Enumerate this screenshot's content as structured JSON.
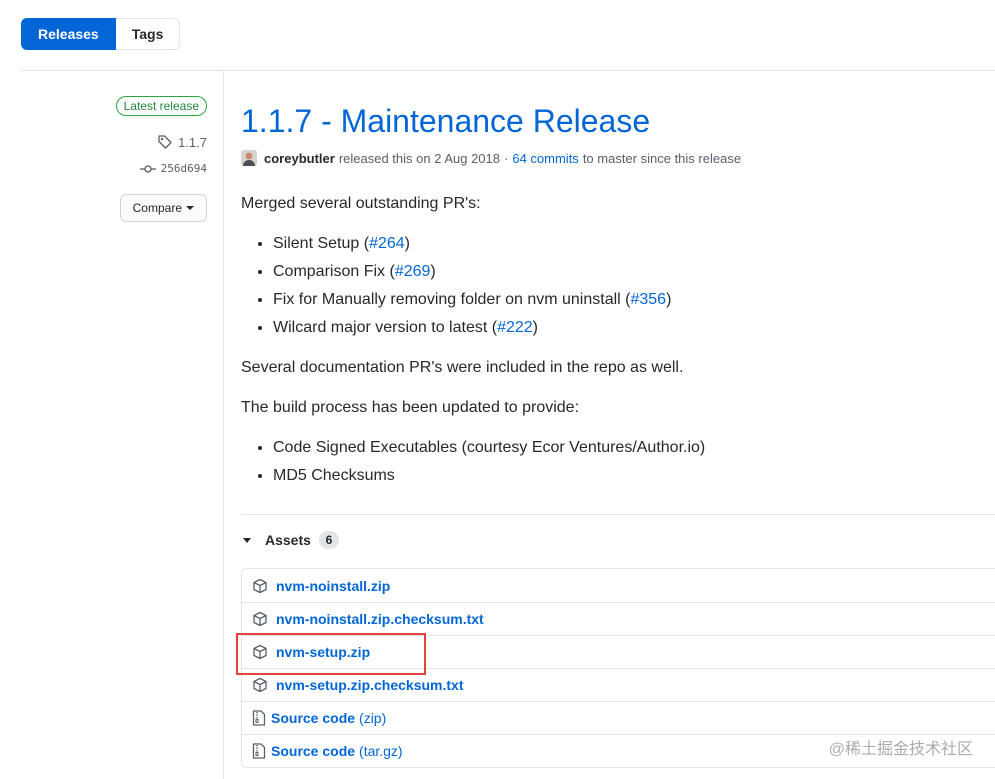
{
  "tabs": [
    {
      "label": "Releases",
      "active": true
    },
    {
      "label": "Tags",
      "active": false
    }
  ],
  "meta": {
    "latest_badge": "Latest release",
    "tag": "1.1.7",
    "commit": "256d694",
    "compare_label": "Compare"
  },
  "release": {
    "title": "1.1.7 - Maintenance Release",
    "author": "coreybutler",
    "released_text": "released this on 2 Aug 2018",
    "separator": "·",
    "commits_link": "64 commits",
    "commits_suffix": "to master since this release"
  },
  "notes": {
    "intro": "Merged several outstanding PR's:",
    "prs": [
      {
        "text": "Silent Setup (",
        "link": "#264",
        "close": ")"
      },
      {
        "text": "Comparison Fix (",
        "link": "#269",
        "close": ")"
      },
      {
        "text": "Fix for Manually removing folder on nvm uninstall (",
        "link": "#356",
        "close": ")"
      },
      {
        "text": "Wilcard major version to latest (",
        "link": "#222",
        "close": ")"
      }
    ],
    "docs_line": "Several documentation PR's were included in the repo as well.",
    "build_intro": "The build process has been updated to provide:",
    "build_items": [
      "Code Signed Executables (courtesy Ecor Ventures/Author.io)",
      "MD5 Checksums"
    ]
  },
  "assets": {
    "label": "Assets",
    "count": "6",
    "files": [
      "nvm-noinstall.zip",
      "nvm-noinstall.zip.checksum.txt",
      "nvm-setup.zip",
      "nvm-setup.zip.checksum.txt"
    ],
    "sources": [
      {
        "name": "Source code",
        "ext": "(zip)"
      },
      {
        "name": "Source code",
        "ext": "(tar.gz)"
      }
    ]
  },
  "watermark": "@稀土掘金技术社区",
  "colors": {
    "accent": "#0366d6",
    "latest_green": "#28a745",
    "highlight_red": "#e2433a"
  }
}
